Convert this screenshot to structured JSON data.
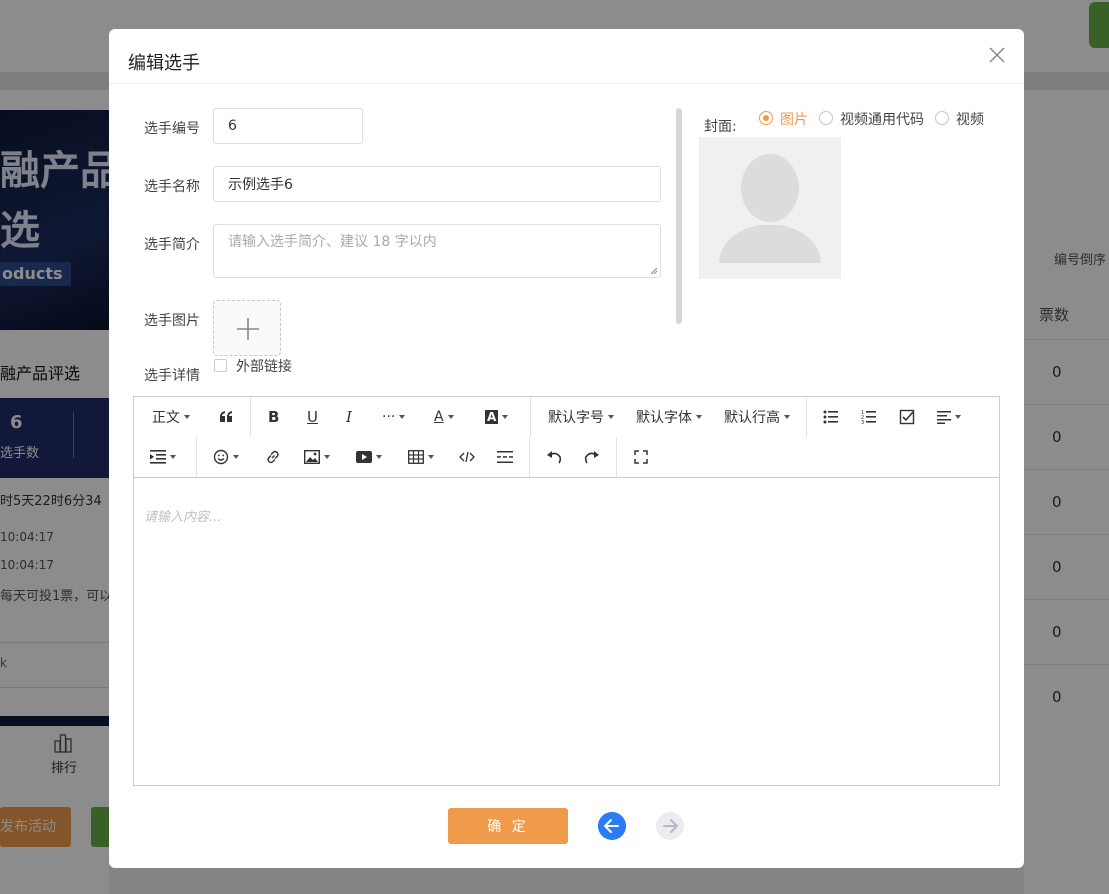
{
  "modal": {
    "title": "编辑选手",
    "fields": {
      "number_label": "选手编号",
      "number_value": "6",
      "name_label": "选手名称",
      "name_value": "示例选手6",
      "intro_label": "选手简介",
      "intro_placeholder": "请输入选手简介、建议 18 字以内",
      "image_label": "选手图片",
      "detail_label": "选手详情",
      "external_link_label": "外部链接"
    },
    "cover": {
      "label": "封面:",
      "options": [
        "图片",
        "视频通用代码",
        "视频"
      ],
      "selected": "图片"
    },
    "editor": {
      "toolbar": {
        "paragraph": "正文",
        "font_size": "默认字号",
        "font_family": "默认字体",
        "line_height": "默认行高",
        "more": "···",
        "font_color": "A",
        "bg_color": "A"
      },
      "placeholder": "请输入内容..."
    },
    "confirm_label": "确 定"
  },
  "background": {
    "banner_line1": "融产品",
    "banner_line2": "选",
    "banner_line3": "oducts",
    "activity_title": "融产品评选",
    "stat_number": "6",
    "stat_label": "选手数",
    "countdown": "时5天22时6分34",
    "time1": "10:04:17",
    "time2": "10:04:17",
    "rule": "每天可投1票，可以",
    "tiny": "k",
    "rank_label": "排行",
    "publish_label": "发布活动",
    "sort_label": "编号倒序",
    "votes_header": "票数",
    "vote_values": [
      "0",
      "0",
      "0",
      "0",
      "0",
      "0"
    ]
  },
  "colors": {
    "accent": "#ef9b4b",
    "primary_blue": "#2d7bf4",
    "green": "#67b047"
  }
}
